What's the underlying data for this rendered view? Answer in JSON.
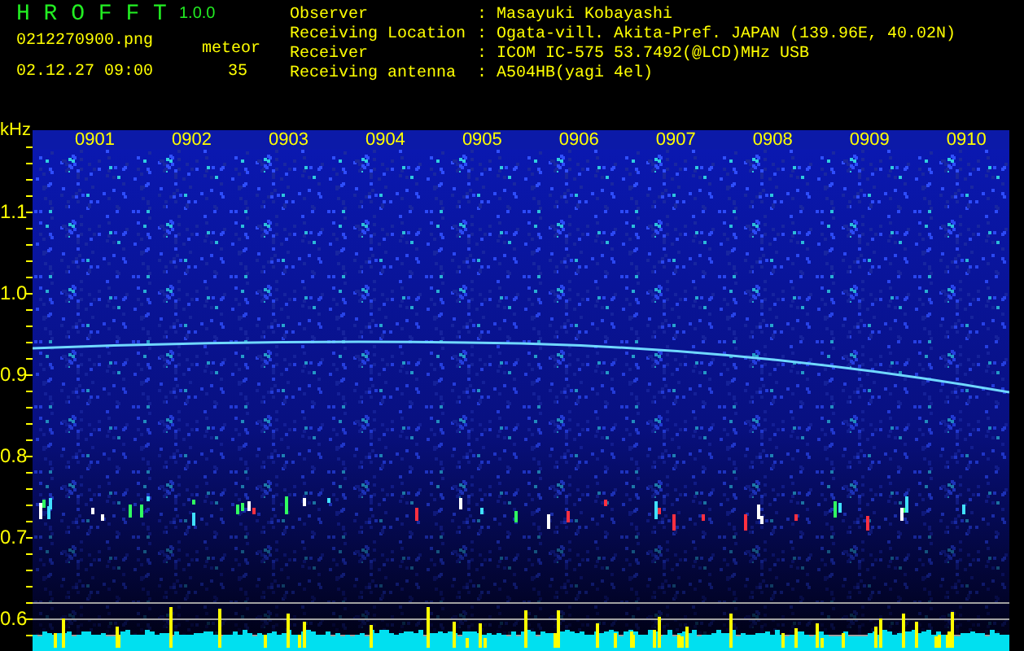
{
  "app": {
    "title": "H R O F F T",
    "version": "1.0.0"
  },
  "file": {
    "name": "0212270900.png",
    "datetime": "02.12.27 09:00"
  },
  "meteor": {
    "label": "meteor",
    "count": "35"
  },
  "info": [
    {
      "label": "Observer",
      "value": ": Masayuki Kobayashi"
    },
    {
      "label": "Receiving Location",
      "value": ": Ogata-vill. Akita-Pref. JAPAN (139.96E, 40.02N)"
    },
    {
      "label": "Receiver",
      "value": ": ICOM IC-575 53.7492(@LCD)MHz USB"
    },
    {
      "label": "Receiving antenna",
      "value": ": A504HB(yagi 4el)"
    }
  ],
  "axis": {
    "unit": "kHz",
    "y_labels": [
      "1.1",
      "1.0",
      "0.9",
      "0.8",
      "0.7",
      "0.6"
    ],
    "time_labels": [
      "0901",
      "0902",
      "0903",
      "0904",
      "0905",
      "0906",
      "0907",
      "0908",
      "0909",
      "0910"
    ]
  }
}
